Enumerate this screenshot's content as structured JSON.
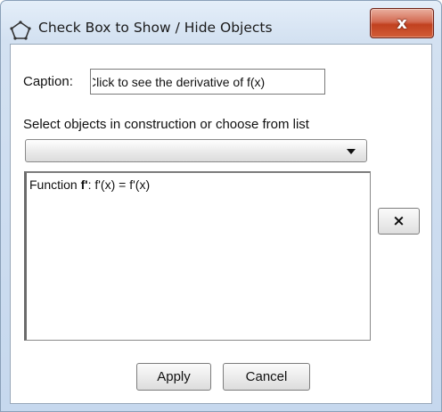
{
  "window": {
    "title": "Check Box to Show / Hide Objects",
    "close_label": "x"
  },
  "caption": {
    "label": "Caption:",
    "value": "Click to see the derivative of f(x)"
  },
  "selection": {
    "label": "Select objects in construction or choose from list",
    "dropdown_value": ""
  },
  "object_list": {
    "items": [
      {
        "prefix": "Function ",
        "name": "f'",
        "definition": ": f'(x) = f'(x)"
      }
    ],
    "remove_label": "×"
  },
  "buttons": {
    "apply_label": "Apply",
    "cancel_label": "Cancel"
  },
  "colors": {
    "title_gradient_top": "#e4eef9",
    "close_button": "#c1411f",
    "client_background": "#ffffff"
  },
  "icons": {
    "window_icon": "pentagon-outline-icon",
    "close_icon": "close-icon",
    "dropdown_icon": "chevron-down-icon",
    "remove_icon": "remove-icon"
  }
}
